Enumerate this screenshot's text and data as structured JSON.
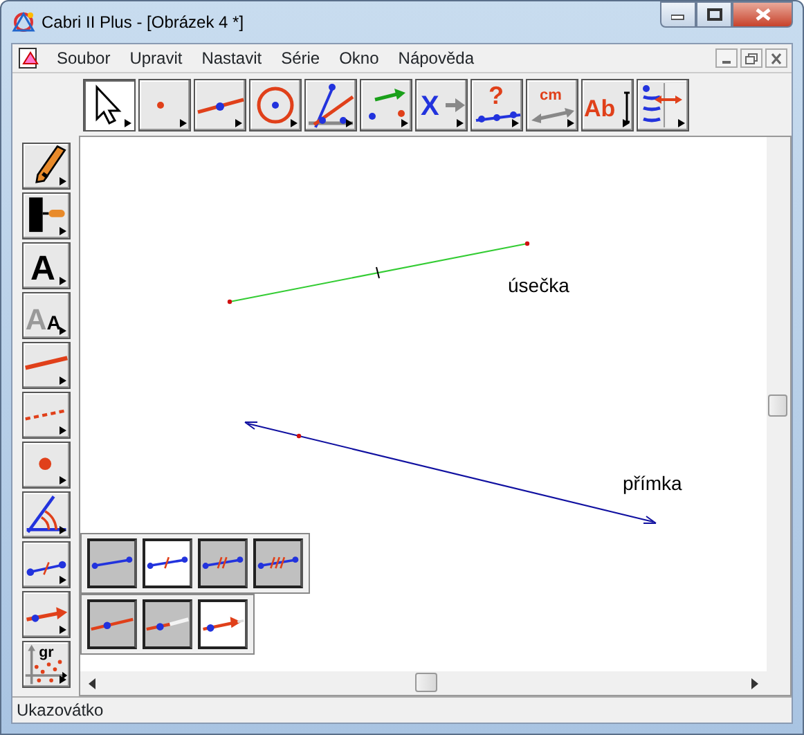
{
  "window": {
    "title": "Cabri II Plus - [Obrázek 4 *]"
  },
  "menu": [
    "Soubor",
    "Upravit",
    "Nastavit",
    "Série",
    "Okno",
    "Nápověda"
  ],
  "toolbar": [
    {
      "kind": "pointer",
      "selected": true
    },
    {
      "kind": "point",
      "selected": false
    },
    {
      "kind": "line",
      "selected": false
    },
    {
      "kind": "circle",
      "selected": false
    },
    {
      "kind": "construct",
      "selected": false
    },
    {
      "kind": "transform",
      "selected": false
    },
    {
      "kind": "macro",
      "selected": false,
      "text": "X"
    },
    {
      "kind": "check",
      "selected": false,
      "text": "?"
    },
    {
      "kind": "measure",
      "selected": false,
      "text": "cm"
    },
    {
      "kind": "text",
      "selected": false,
      "text": "Ab"
    },
    {
      "kind": "attributes",
      "selected": false
    }
  ],
  "side_toolbar": [
    {
      "kind": "pencil"
    },
    {
      "kind": "paint"
    },
    {
      "kind": "font",
      "text": "A"
    },
    {
      "kind": "size",
      "text": "AA"
    },
    {
      "kind": "thickness"
    },
    {
      "kind": "dashed"
    },
    {
      "kind": "dot"
    },
    {
      "kind": "angle"
    },
    {
      "kind": "mark"
    },
    {
      "kind": "arrow"
    },
    {
      "kind": "axes",
      "text": "gr"
    }
  ],
  "canvas": {
    "objects": [
      {
        "kind": "segment",
        "label": "úsečka"
      },
      {
        "kind": "line",
        "label": "přímka"
      }
    ]
  },
  "palette": {
    "rows": [
      [
        {
          "kind": "seg0",
          "selected": false
        },
        {
          "kind": "seg1",
          "selected": true
        },
        {
          "kind": "seg2",
          "selected": false
        },
        {
          "kind": "seg3",
          "selected": false
        }
      ],
      [
        {
          "kind": "line",
          "selected": false
        },
        {
          "kind": "ray",
          "selected": false
        },
        {
          "kind": "arrow",
          "selected": true
        }
      ]
    ]
  },
  "status_bar": "Ukazovátko"
}
